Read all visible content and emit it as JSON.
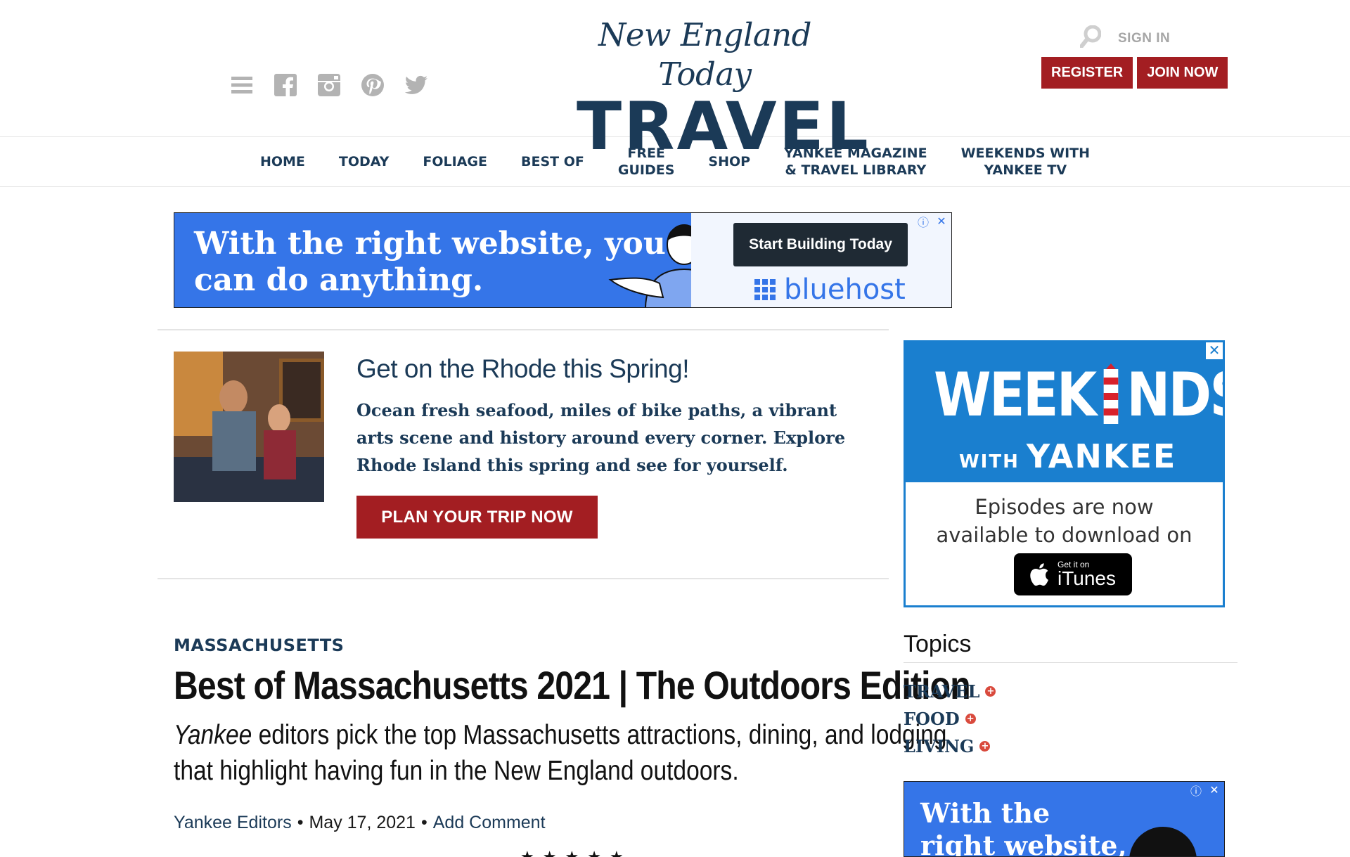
{
  "header": {
    "logo_script": "New England Today",
    "logo_main": "TRAVEL",
    "sign_in": "SIGN IN",
    "register": "REGISTER",
    "join_now": "JOIN NOW",
    "social_icons": [
      "menu-icon",
      "facebook-icon",
      "instagram-icon",
      "pinterest-icon",
      "twitter-icon"
    ]
  },
  "nav": {
    "items": [
      "HOME",
      "TODAY",
      "FOLIAGE",
      "BEST OF",
      "FREE\nGUIDES",
      "SHOP",
      "YANKEE MAGAZINE\n& TRAVEL LIBRARY",
      "WEEKENDS WITH\nYANKEE TV"
    ]
  },
  "ad_top": {
    "text_line1": "With the right website, you",
    "text_line2": "can do anything.",
    "cta": "Start Building Today",
    "brand": "bluehost"
  },
  "promo": {
    "title": "Get on the Rhode this Spring!",
    "text": "Ocean fresh seafood, miles of bike paths, a vibrant arts scene and history around every corner. Explore Rhode Island this spring and see for yourself.",
    "button": "PLAN YOUR TRIP NOW"
  },
  "article": {
    "category": "MASSACHUSETTS",
    "title": "Best of Massachusetts 2021 | The Outdoors Edition",
    "dek_italic": "Yankee",
    "dek_line1_rest": " editors pick the top Massachusetts attractions, dining, and lodging",
    "dek_line2": "that highlight having fun in the New England outdoors.",
    "author": "Yankee Editors",
    "sep": "•",
    "date": "May 17, 2021",
    "comment": "Add Comment"
  },
  "ad_side": {
    "title_pre": "WEEK",
    "title_post": "NDS",
    "with": "WITH",
    "yankee": "YANKEE",
    "episodes_line1": "Episodes are now",
    "episodes_line2": "available to download on",
    "itunes_small": "Get it on",
    "itunes_big": "iTunes"
  },
  "topics": {
    "heading": "Topics",
    "items": [
      "TRAVEL",
      "FOOD",
      "LIVING"
    ]
  },
  "ad_side2": {
    "line1": "With the",
    "line2": "right website,"
  },
  "colors": {
    "brand_navy": "#1b3a57",
    "brand_red": "#a31e22",
    "ad_blue": "#3575e8",
    "weekends_blue": "#1a7fcf"
  }
}
